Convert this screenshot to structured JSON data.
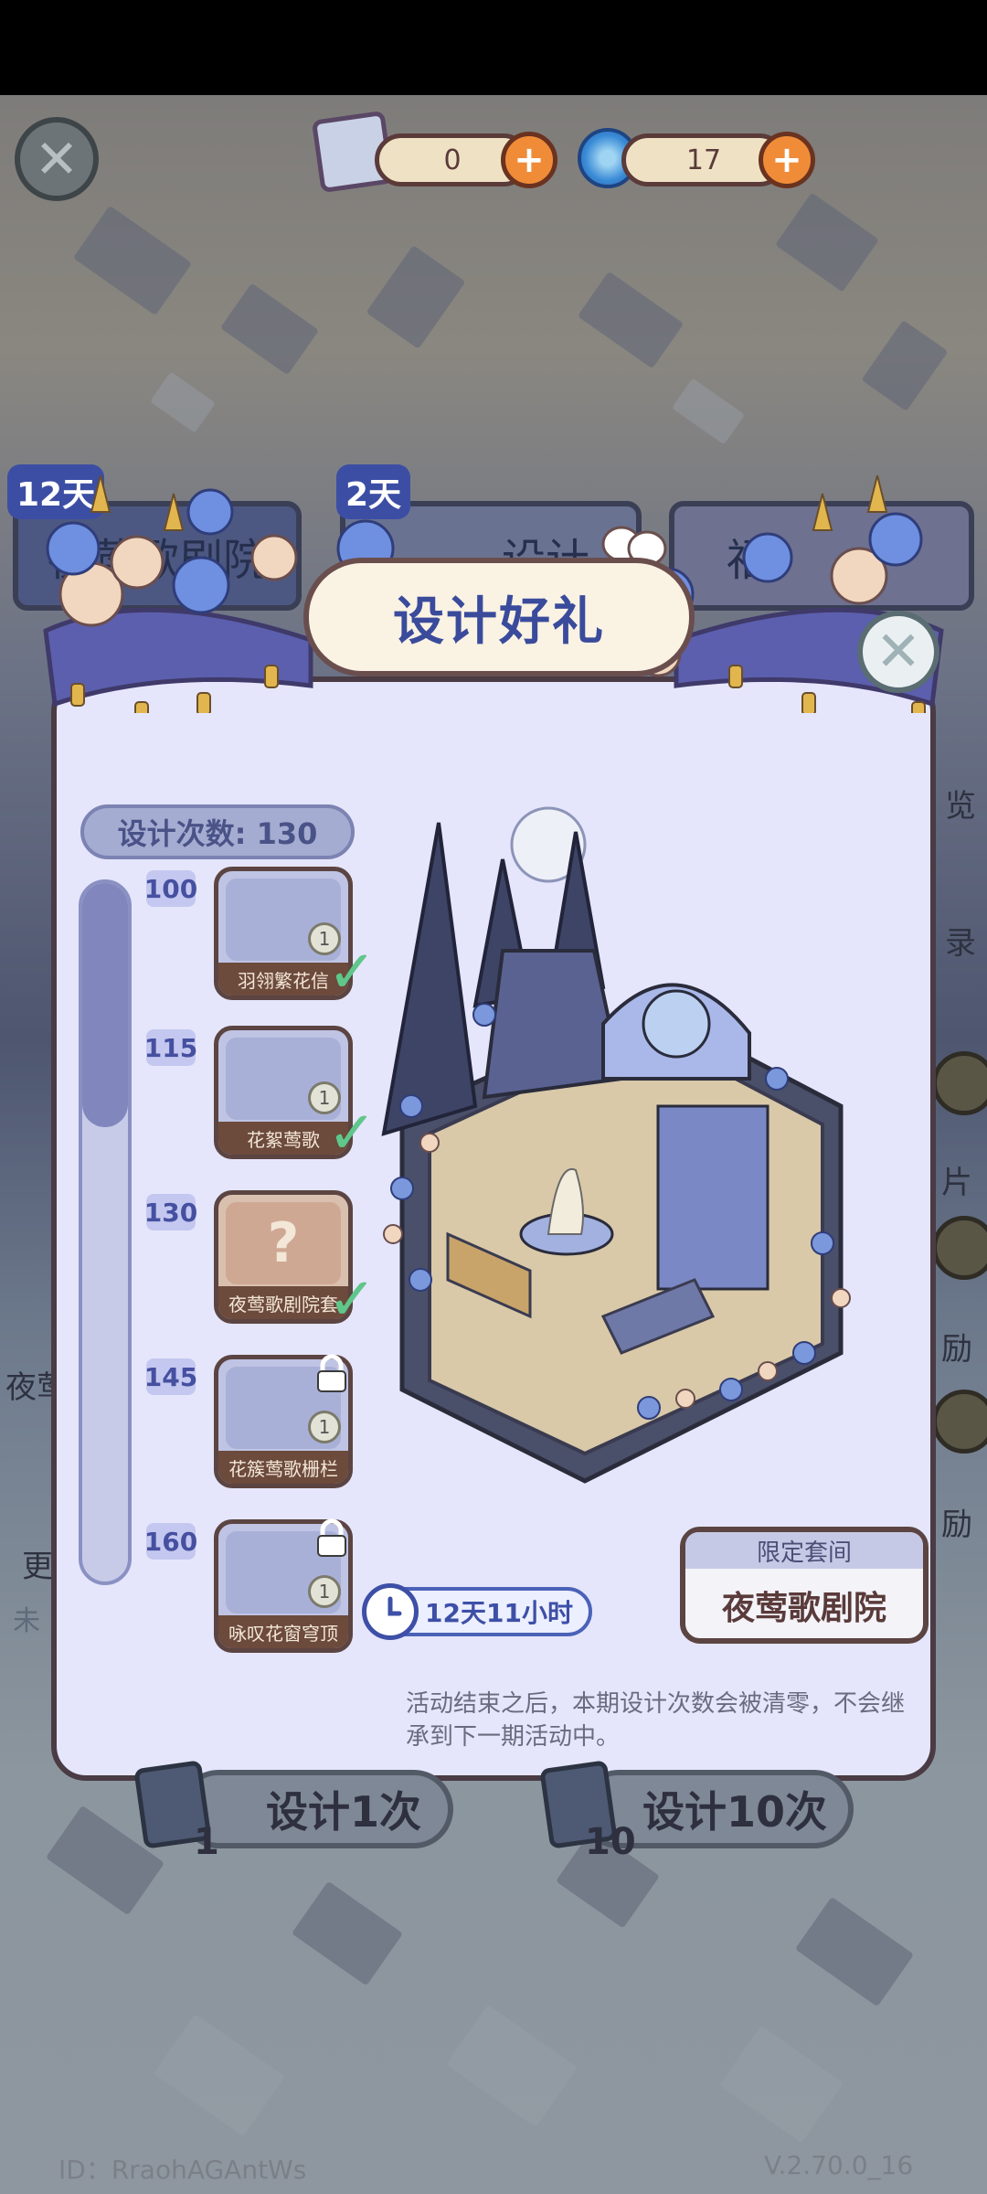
{
  "colors": {
    "accent": "#3a4b9c",
    "check": "#5fc78a",
    "plus": "#f08c38",
    "modal_bg": "#e5e6fb"
  },
  "top_bar": {
    "scroll_count": "0",
    "swirl_count": "17",
    "icons": [
      "close-icon",
      "blueprint-scroll-icon",
      "plus-icon",
      "swirl-coin-icon",
      "plus-icon"
    ]
  },
  "background_tabs": [
    {
      "days": "12天",
      "label": "夜莺歌剧院"
    },
    {
      "days": "2天",
      "label": "设计"
    },
    {
      "label": "福"
    }
  ],
  "background_side": {
    "left_label_1": "夜莺",
    "left_label_2": "更",
    "left_label_3": "未",
    "right_labels": [
      "览",
      "录",
      "片",
      "励",
      "励"
    ]
  },
  "modal": {
    "title": "设计好礼",
    "design_count_label": "设计次数: 130",
    "progress": 0.35,
    "milestones": [
      {
        "count": "100",
        "reward": "羽翎繁花信",
        "qty": "1",
        "status": "claimed"
      },
      {
        "count": "115",
        "reward": "花絮莺歌",
        "qty": "1",
        "status": "claimed"
      },
      {
        "count": "130",
        "reward": "夜莺歌剧院套",
        "qty": "",
        "status": "claimed"
      },
      {
        "count": "145",
        "reward": "花簇莺歌栅栏",
        "qty": "1",
        "status": "locked"
      },
      {
        "count": "160",
        "reward": "咏叹花窗穹顶",
        "qty": "1",
        "status": "locked"
      }
    ],
    "limited": {
      "header": "限定套间",
      "name": "夜莺歌剧院"
    },
    "timer": "12天11小时",
    "notice": "活动结束之后，本期设计次数会被清零，不会继承到下一期活动中。"
  },
  "actions": {
    "design_once": {
      "label": "设计1次",
      "cost": "1"
    },
    "design_ten": {
      "label": "设计10次",
      "cost": "10"
    }
  },
  "footer": {
    "id": "ID：RraohAGAntWs",
    "version": "V.2.70.0_16"
  }
}
